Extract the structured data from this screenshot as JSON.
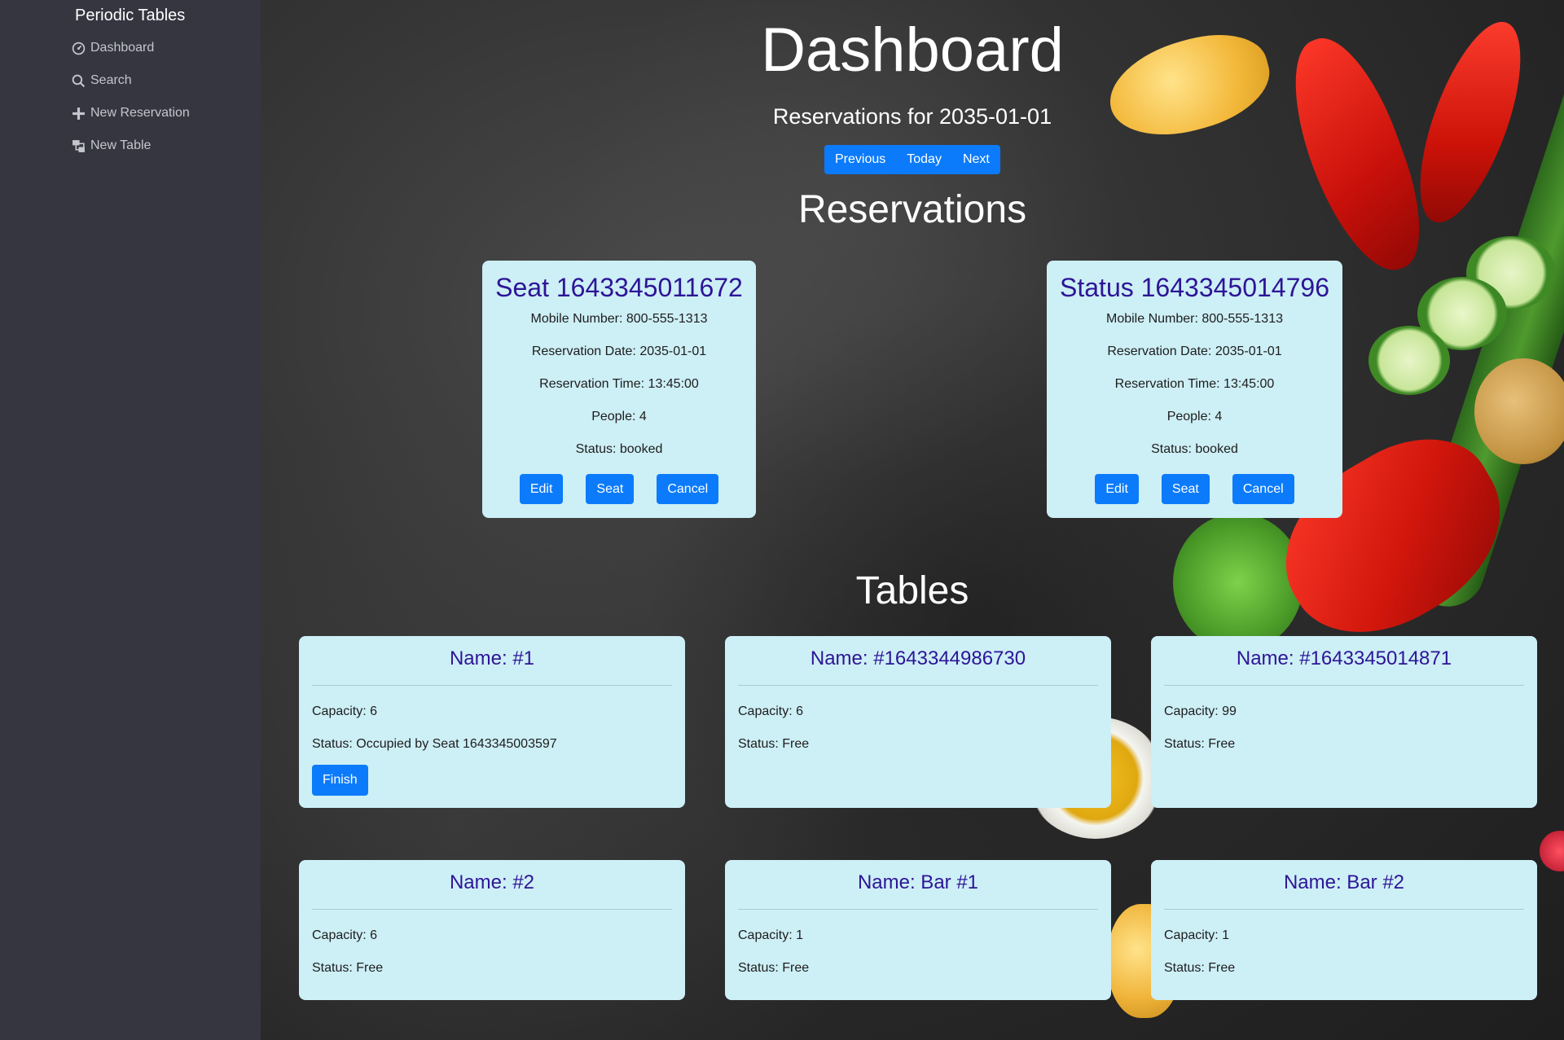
{
  "sidebar": {
    "brand": "Periodic Tables",
    "items": [
      {
        "label": "Dashboard",
        "icon": "dashboard-icon"
      },
      {
        "label": "Search",
        "icon": "search-icon"
      },
      {
        "label": "New Reservation",
        "icon": "plus-icon"
      },
      {
        "label": "New Table",
        "icon": "layers-icon"
      }
    ]
  },
  "header": {
    "title": "Dashboard",
    "subtitle": "Reservations for 2035-01-01",
    "nav": {
      "previous": "Previous",
      "today": "Today",
      "next": "Next"
    }
  },
  "reservations": {
    "title": "Reservations",
    "cards": [
      {
        "heading": "Seat 1643345011672",
        "mobile": "Mobile Number: 800-555-1313",
        "date": "Reservation Date: 2035-01-01",
        "time": "Reservation Time: 13:45:00",
        "people": "People: 4",
        "status": "Status: booked",
        "edit": "Edit",
        "seat": "Seat",
        "cancel": "Cancel"
      },
      {
        "heading": "Status 1643345014796",
        "mobile": "Mobile Number: 800-555-1313",
        "date": "Reservation Date: 2035-01-01",
        "time": "Reservation Time: 13:45:00",
        "people": "People: 4",
        "status": "Status: booked",
        "edit": "Edit",
        "seat": "Seat",
        "cancel": "Cancel"
      }
    ]
  },
  "tables": {
    "title": "Tables",
    "cards": [
      {
        "name": "Name: #1",
        "capacity": "Capacity: 6",
        "status": "Status: Occupied by Seat 1643345003597",
        "finish": "Finish"
      },
      {
        "name": "Name: #1643344986730",
        "capacity": "Capacity: 6",
        "status": "Status: Free"
      },
      {
        "name": "Name: #1643345014871",
        "capacity": "Capacity: 99",
        "status": "Status: Free"
      },
      {
        "name": "Name: #2",
        "capacity": "Capacity: 6",
        "status": "Status: Free"
      },
      {
        "name": "Name: Bar #1",
        "capacity": "Capacity: 1",
        "status": "Status: Free"
      },
      {
        "name": "Name: Bar #2",
        "capacity": "Capacity: 1",
        "status": "Status: Free"
      }
    ]
  },
  "colors": {
    "sidebar_bg": "#353640",
    "card_bg": "#cdeff6",
    "card_heading": "#2d1596",
    "button_primary": "#0b7bfb"
  }
}
